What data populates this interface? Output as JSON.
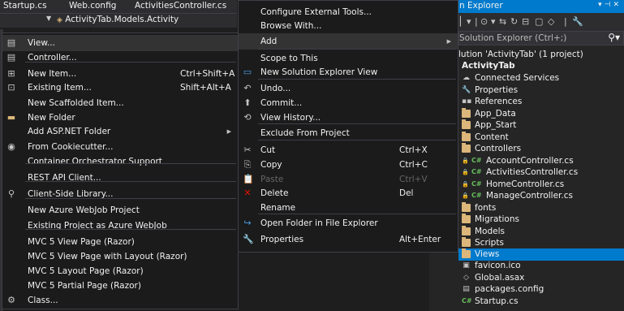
{
  "doc_tabs": [
    "Startup.cs",
    "Web.config",
    "ActivitiesController.cs"
  ],
  "nav_bar": {
    "combo": "ActivityTab.Models.Activity"
  },
  "left_menu": {
    "items": [
      {
        "label": "View...",
        "icon": "view-page-icon",
        "shortcut": ""
      },
      {
        "label": "Controller...",
        "icon": "controller-icon",
        "shortcut": ""
      },
      {
        "label": "New Item...",
        "icon": "new-item-icon",
        "shortcut": "Ctrl+Shift+A"
      },
      {
        "label": "Existing Item...",
        "icon": "existing-item-icon",
        "shortcut": "Shift+Alt+A"
      },
      {
        "label": "New Scaffolded Item...",
        "icon": "",
        "shortcut": ""
      },
      {
        "label": "New Folder",
        "icon": "new-folder-icon",
        "shortcut": ""
      },
      {
        "label": "Add ASP.NET Folder",
        "icon": "",
        "shortcut": "",
        "submenu": true
      },
      {
        "label": "From Cookiecutter...",
        "icon": "cookiecutter-icon",
        "shortcut": ""
      },
      {
        "label": "Container Orchestrator Support",
        "icon": "",
        "shortcut": ""
      },
      {
        "label": "REST API Client...",
        "icon": "",
        "shortcut": ""
      },
      {
        "label": "Client-Side Library...",
        "icon": "client-library-icon",
        "shortcut": ""
      },
      {
        "label": "New Azure WebJob Project",
        "icon": "",
        "shortcut": ""
      },
      {
        "label": "Existing Project as Azure WebJob",
        "icon": "",
        "shortcut": ""
      },
      {
        "label": "MVC 5 View Page (Razor)",
        "icon": "",
        "shortcut": ""
      },
      {
        "label": "MVC 5 View Page with Layout (Razor)",
        "icon": "",
        "shortcut": ""
      },
      {
        "label": "MVC 5 Layout Page (Razor)",
        "icon": "",
        "shortcut": ""
      },
      {
        "label": "MVC 5 Partial Page (Razor)",
        "icon": "",
        "shortcut": ""
      },
      {
        "label": "Class...",
        "icon": "class-icon",
        "shortcut": ""
      }
    ]
  },
  "right_menu": {
    "items": [
      {
        "label": "Configure External Tools...",
        "shortcut": ""
      },
      {
        "label": "Browse With...",
        "shortcut": ""
      },
      {
        "label": "Add",
        "shortcut": "",
        "submenu": true
      },
      {
        "label": "Scope to This",
        "shortcut": ""
      },
      {
        "label": "New Solution Explorer View",
        "shortcut": ""
      },
      {
        "label": "Undo...",
        "shortcut": ""
      },
      {
        "label": "Commit...",
        "shortcut": ""
      },
      {
        "label": "View History...",
        "shortcut": ""
      },
      {
        "label": "Exclude From Project",
        "shortcut": ""
      },
      {
        "label": "Cut",
        "shortcut": "Ctrl+X"
      },
      {
        "label": "Copy",
        "shortcut": "Ctrl+C"
      },
      {
        "label": "Paste",
        "shortcut": "Ctrl+V"
      },
      {
        "label": "Delete",
        "shortcut": "Del"
      },
      {
        "label": "Rename",
        "shortcut": ""
      },
      {
        "label": "Open Folder in File Explorer",
        "shortcut": ""
      },
      {
        "label": "Properties",
        "shortcut": "Alt+Enter"
      }
    ]
  },
  "solution_explorer": {
    "title": "Solution Explorer",
    "title_visible": "n Explorer",
    "search_placeholder": "Solution Explorer (Ctrl+;)",
    "search_visible": "Solution Explorer (Ctrl+;)",
    "colors": {
      "selection": "#007acc",
      "folder": "#dcb67a",
      "csharp": "#68bf5b"
    },
    "tree": [
      {
        "label": "lution 'ActivityTab' (1 project)",
        "icon": "solution-icon"
      },
      {
        "label": "ActivityTab",
        "icon": "project-icon",
        "bold": true
      },
      {
        "label": "Connected Services",
        "icon": "connected-services-icon"
      },
      {
        "label": "Properties",
        "icon": "properties-icon"
      },
      {
        "label": "References",
        "icon": "references-icon"
      },
      {
        "label": "App_Data",
        "icon": "folder-icon"
      },
      {
        "label": "App_Start",
        "icon": "folder-icon"
      },
      {
        "label": "Content",
        "icon": "folder-icon"
      },
      {
        "label": "Controllers",
        "icon": "folder-icon"
      },
      {
        "label": "AccountController.cs",
        "icon": "csharp-file-icon"
      },
      {
        "label": "ActivitiesController.cs",
        "icon": "csharp-file-icon"
      },
      {
        "label": "HomeController.cs",
        "icon": "csharp-file-icon"
      },
      {
        "label": "ManageController.cs",
        "icon": "csharp-file-icon"
      },
      {
        "label": "fonts",
        "icon": "folder-icon"
      },
      {
        "label": "Migrations",
        "icon": "folder-icon"
      },
      {
        "label": "Models",
        "icon": "folder-icon"
      },
      {
        "label": "Scripts",
        "icon": "folder-icon"
      },
      {
        "label": "Views",
        "icon": "folder-icon",
        "selected": true
      },
      {
        "label": "favicon.ico",
        "icon": "image-file-icon"
      },
      {
        "label": "Global.asax",
        "icon": "asax-file-icon"
      },
      {
        "label": "packages.config",
        "icon": "config-file-icon"
      },
      {
        "label": "Startup.cs",
        "icon": "csharp-file-icon"
      }
    ]
  }
}
